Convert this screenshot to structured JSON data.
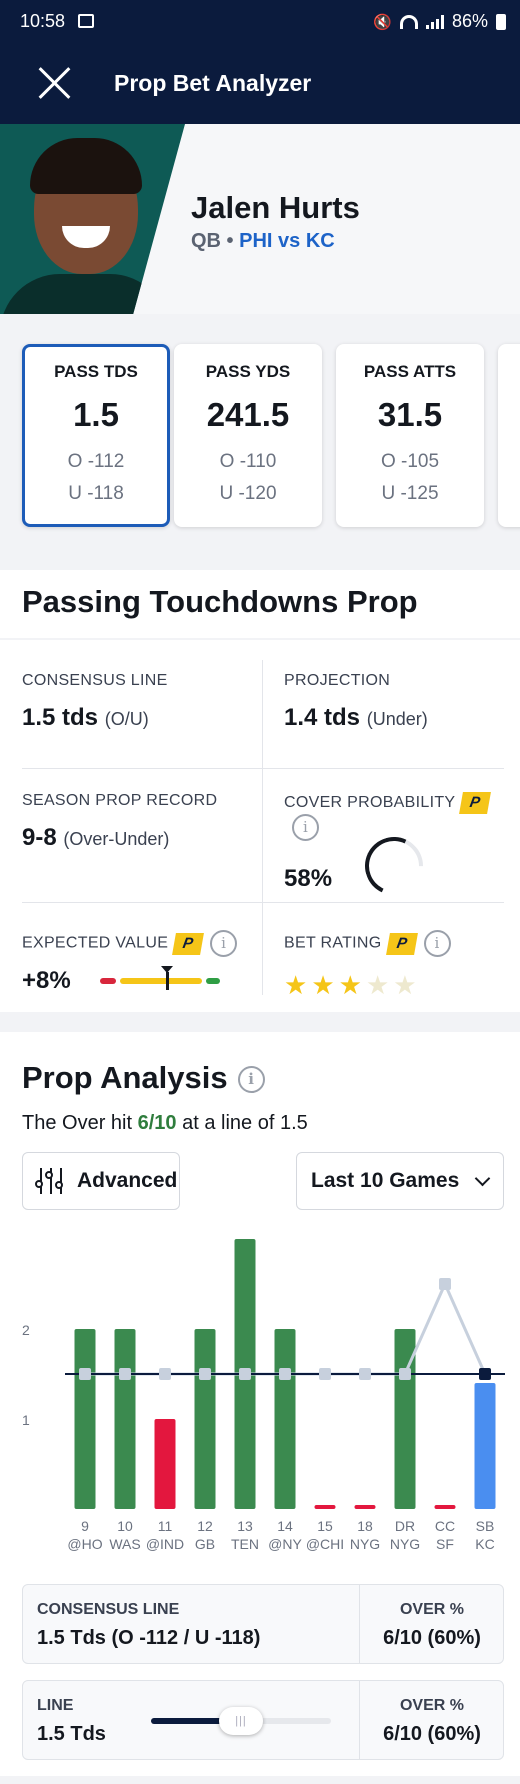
{
  "status_bar": {
    "time": "10:58",
    "battery": "86%"
  },
  "app_bar": {
    "title": "Prop Bet Analyzer"
  },
  "player": {
    "name": "Jalen Hurts",
    "position": "QB •",
    "matchup": "PHI vs KC"
  },
  "prop_cards": [
    {
      "label": "PASS TDS",
      "line": "1.5",
      "over": "O -112",
      "under": "U -118",
      "selected": true
    },
    {
      "label": "PASS YDS",
      "line": "241.5",
      "over": "O -110",
      "under": "U -120",
      "selected": false
    },
    {
      "label": "PASS ATTS",
      "line": "31.5",
      "over": "O -105",
      "under": "U -125",
      "selected": false
    }
  ],
  "prop_section": {
    "title": "Passing Touchdowns Prop",
    "consensus_line": {
      "caption": "CONSENSUS LINE",
      "value": "1.5 tds",
      "note": "(O/U)"
    },
    "projection": {
      "caption": "PROJECTION",
      "value": "1.4 tds",
      "note": "(Under)"
    },
    "season_record": {
      "caption": "SEASON PROP RECORD",
      "value": "9-8",
      "note": "(Over-Under)"
    },
    "cover_probability": {
      "caption": "COVER PROBABILITY",
      "value": "58%",
      "badge": "P",
      "info": "i",
      "gauge_fraction": 0.58
    },
    "expected_value": {
      "caption": "EXPECTED VALUE",
      "value": "+8%",
      "badge": "P",
      "info": "i"
    },
    "bet_rating": {
      "caption": "BET RATING",
      "badge": "P",
      "info": "i",
      "stars_filled": 3,
      "stars_total": 5
    }
  },
  "analysis": {
    "title": "Prop Analysis",
    "info": "i",
    "hit_prefix": "The Over hit",
    "hit_value": "6/10",
    "hit_suffix": "at a line of 1.5",
    "advanced_label": "Advanced",
    "range_label": "Last 10 Games"
  },
  "chart_data": {
    "type": "bar",
    "y_ticks": [
      "1",
      "2"
    ],
    "line_value": 1.5,
    "ylim": [
      0,
      3
    ],
    "categories": [
      {
        "week": "9",
        "opp": "@HO"
      },
      {
        "week": "10",
        "opp": "WAS"
      },
      {
        "week": "11",
        "opp": "@IND"
      },
      {
        "week": "12",
        "opp": "GB"
      },
      {
        "week": "13",
        "opp": "TEN"
      },
      {
        "week": "14",
        "opp": "@NY"
      },
      {
        "week": "15",
        "opp": "@CHI"
      },
      {
        "week": "18",
        "opp": "NYG"
      },
      {
        "week": "DR",
        "opp": "NYG"
      },
      {
        "week": "CC",
        "opp": "SF"
      },
      {
        "week": "SB",
        "opp": "KC"
      }
    ],
    "values": [
      2,
      2,
      1,
      2,
      3,
      2,
      0,
      0,
      2,
      0,
      1.4
    ],
    "bar_colors": [
      "#3b8a4f",
      "#3b8a4f",
      "#e3173e",
      "#3b8a4f",
      "#3b8a4f",
      "#3b8a4f",
      "#e3173e",
      "#e3173e",
      "#3b8a4f",
      "#e3173e",
      "#4a8ef0"
    ],
    "line_series": [
      1.5,
      1.5,
      1.5,
      1.5,
      1.5,
      1.5,
      1.5,
      1.5,
      1.5,
      2.5,
      1.5
    ]
  },
  "summary_rows": [
    {
      "left_caption": "CONSENSUS LINE",
      "left_value": "1.5 Tds (O -112 / U -118)",
      "right_caption": "OVER %",
      "right_value": "6/10 (60%)"
    },
    {
      "left_caption": "LINE",
      "left_value": "1.5 Tds",
      "right_caption": "OVER %",
      "right_value": "6/10 (60%)",
      "slider_fraction": 0.5
    }
  ],
  "colors": {
    "navy": "#0b1b3d",
    "accent_blue": "#1d63c8",
    "green": "#3b8a4f",
    "red": "#e3173e",
    "gold": "#f5c518"
  }
}
